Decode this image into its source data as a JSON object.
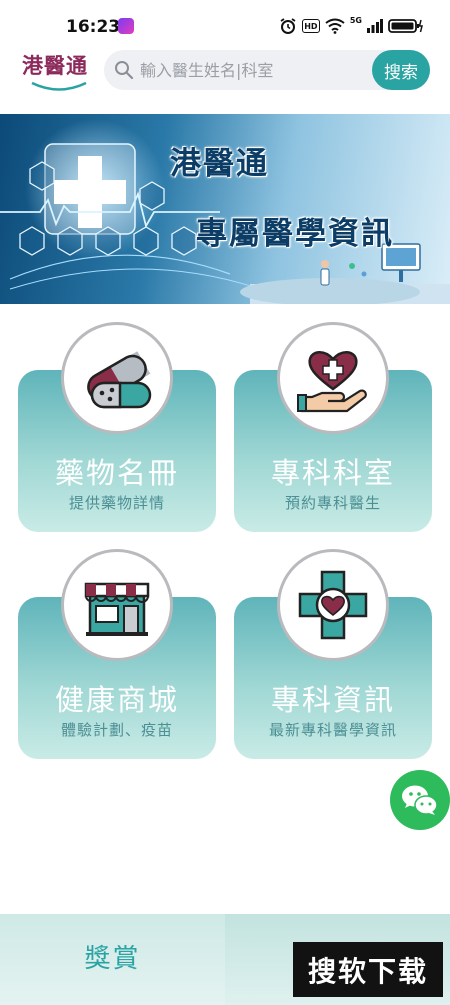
{
  "status_bar": {
    "time": "16:23",
    "hd_badge": "HD",
    "network": "5G"
  },
  "header": {
    "logo_text": "港醫通",
    "search_placeholder": "輸入醫生姓名|科室",
    "search_button": "搜索"
  },
  "banner": {
    "title": "港醫通",
    "subtitle": "專屬醫學資訊"
  },
  "tiles": [
    {
      "title": "藥物名冊",
      "subtitle": "提供藥物詳情",
      "icon": "pill-capsule-icon"
    },
    {
      "title": "專科科室",
      "subtitle": "預約專科醫生",
      "icon": "heart-hand-icon"
    },
    {
      "title": "健康商城",
      "subtitle": "體驗計劃、疫苗",
      "icon": "storefront-icon"
    },
    {
      "title": "專科資訊",
      "subtitle": "最新專科醫學資訊",
      "icon": "medical-cross-heart-icon"
    }
  ],
  "bottom_nav": [
    {
      "label": "獎賞"
    },
    {
      "label": ""
    }
  ],
  "watermark": "搜软下载",
  "colors": {
    "brand_teal": "#2aa3a3",
    "logo_maroon": "#8c2a5c",
    "chat_green": "#2dbb5c"
  }
}
